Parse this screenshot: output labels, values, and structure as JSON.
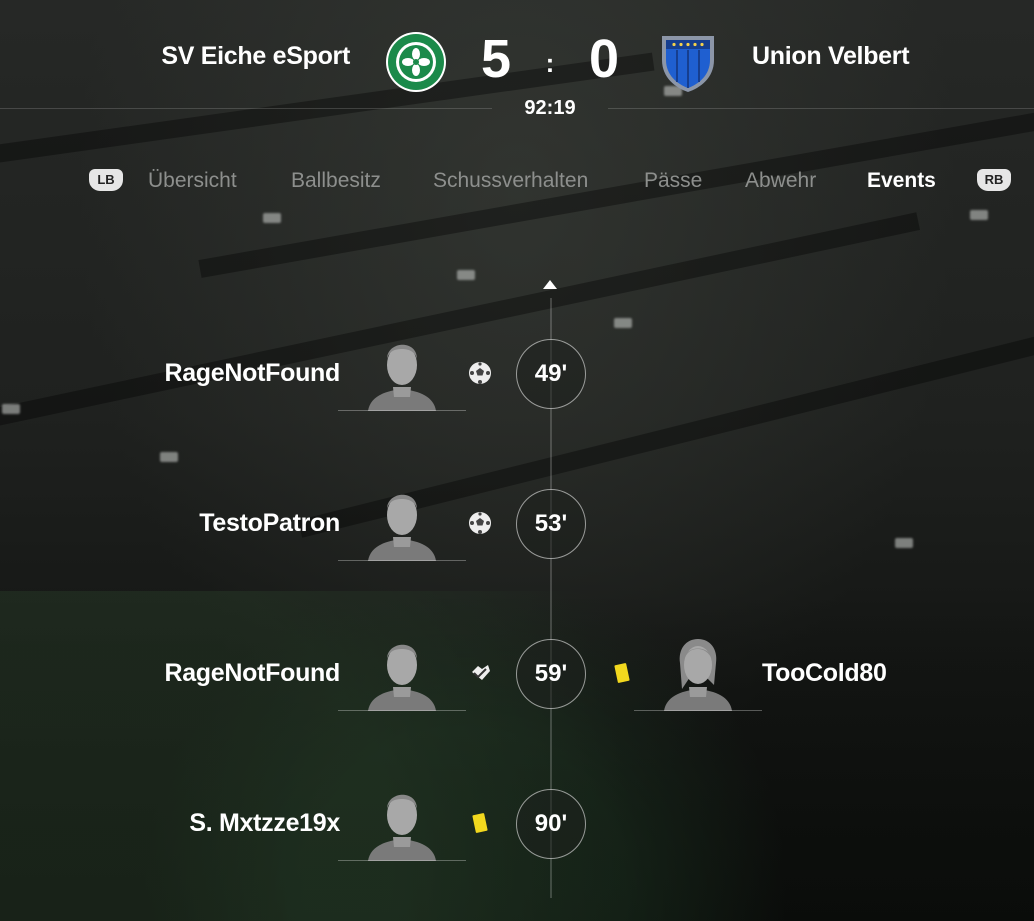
{
  "header": {
    "home_team": "SV Eiche eSport",
    "away_team": "Union Velbert",
    "home_score": "5",
    "away_score": "0",
    "separator": ":",
    "clock": "92:19",
    "home_crest_icon": "celtic-crest-icon",
    "away_crest_icon": "blue-shield-crest-icon"
  },
  "tabs": {
    "left_bumper": "LB",
    "right_bumper": "RB",
    "items": [
      "Übersicht",
      "Ballbesitz",
      "Schussverhalten",
      "Pässe",
      "Abwehr",
      "Events"
    ],
    "active": "Events"
  },
  "events": [
    {
      "minute": "49'",
      "home_player": "RageNotFound",
      "home_icon": "goal-ball-icon",
      "away_player": "",
      "away_icon": ""
    },
    {
      "minute": "53'",
      "home_player": "TestoPatron",
      "home_icon": "goal-ball-icon",
      "away_player": "",
      "away_icon": ""
    },
    {
      "minute": "59'",
      "home_player": "RageNotFound",
      "home_icon": "assist-icon",
      "away_player": "TooCold80",
      "away_icon": "yellow-card-icon"
    },
    {
      "minute": "90'",
      "home_player": "S. Mxtzze19x",
      "home_icon": "yellow-card-icon",
      "away_player": "",
      "away_icon": ""
    }
  ],
  "colors": {
    "accent_active_tab": "#ffffff",
    "inactive_tab": "#8d8f8d",
    "yellow_card": "#f2d81e",
    "home_crest_green": "#1b8a4a",
    "away_crest_blue": "#1f5fd0"
  }
}
